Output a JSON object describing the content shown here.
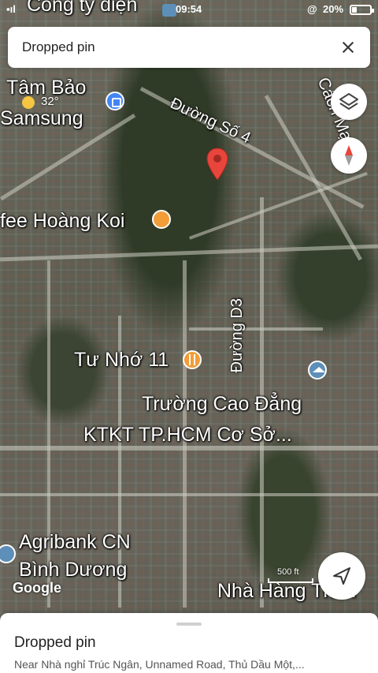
{
  "status_bar": {
    "time": "09:54",
    "battery": "20%"
  },
  "top_card": {
    "title": "Dropped pin"
  },
  "map": {
    "weather": {
      "temperature": "32°"
    },
    "labels": {
      "company": "Công ty điện",
      "tam_bao": "Tâm Bảo",
      "samsung": "Samsung",
      "duong_so_4": "Đường Số 4",
      "cach_mang": "Cách Mạng",
      "cafe": "fee Hoàng Koi",
      "duong_d3": "Đường D3",
      "tu_nho": "Tư Nhớ 11",
      "college_1": "Trường Cao Đẳng",
      "college_2": "KTKT TP.HCM Cơ Sở...",
      "agribank_1": "Agribank CN",
      "agribank_2": "Bình Dương",
      "restaurant": "Nhà Hàng Thân",
      "google": "Google",
      "scale": "500 ft"
    },
    "icons": [
      "shop-icon",
      "cafe-icon",
      "restaurant-icon",
      "school-icon",
      "bank-icon",
      "pin-icon",
      "layers-icon",
      "compass-icon",
      "navigate-icon"
    ],
    "pin_color": "#e8453c"
  },
  "bottom_sheet": {
    "title": "Dropped pin",
    "address": "Near Nhà nghỉ Trúc Ngân, Unnamed Road, Thủ Dầu Một,..."
  }
}
